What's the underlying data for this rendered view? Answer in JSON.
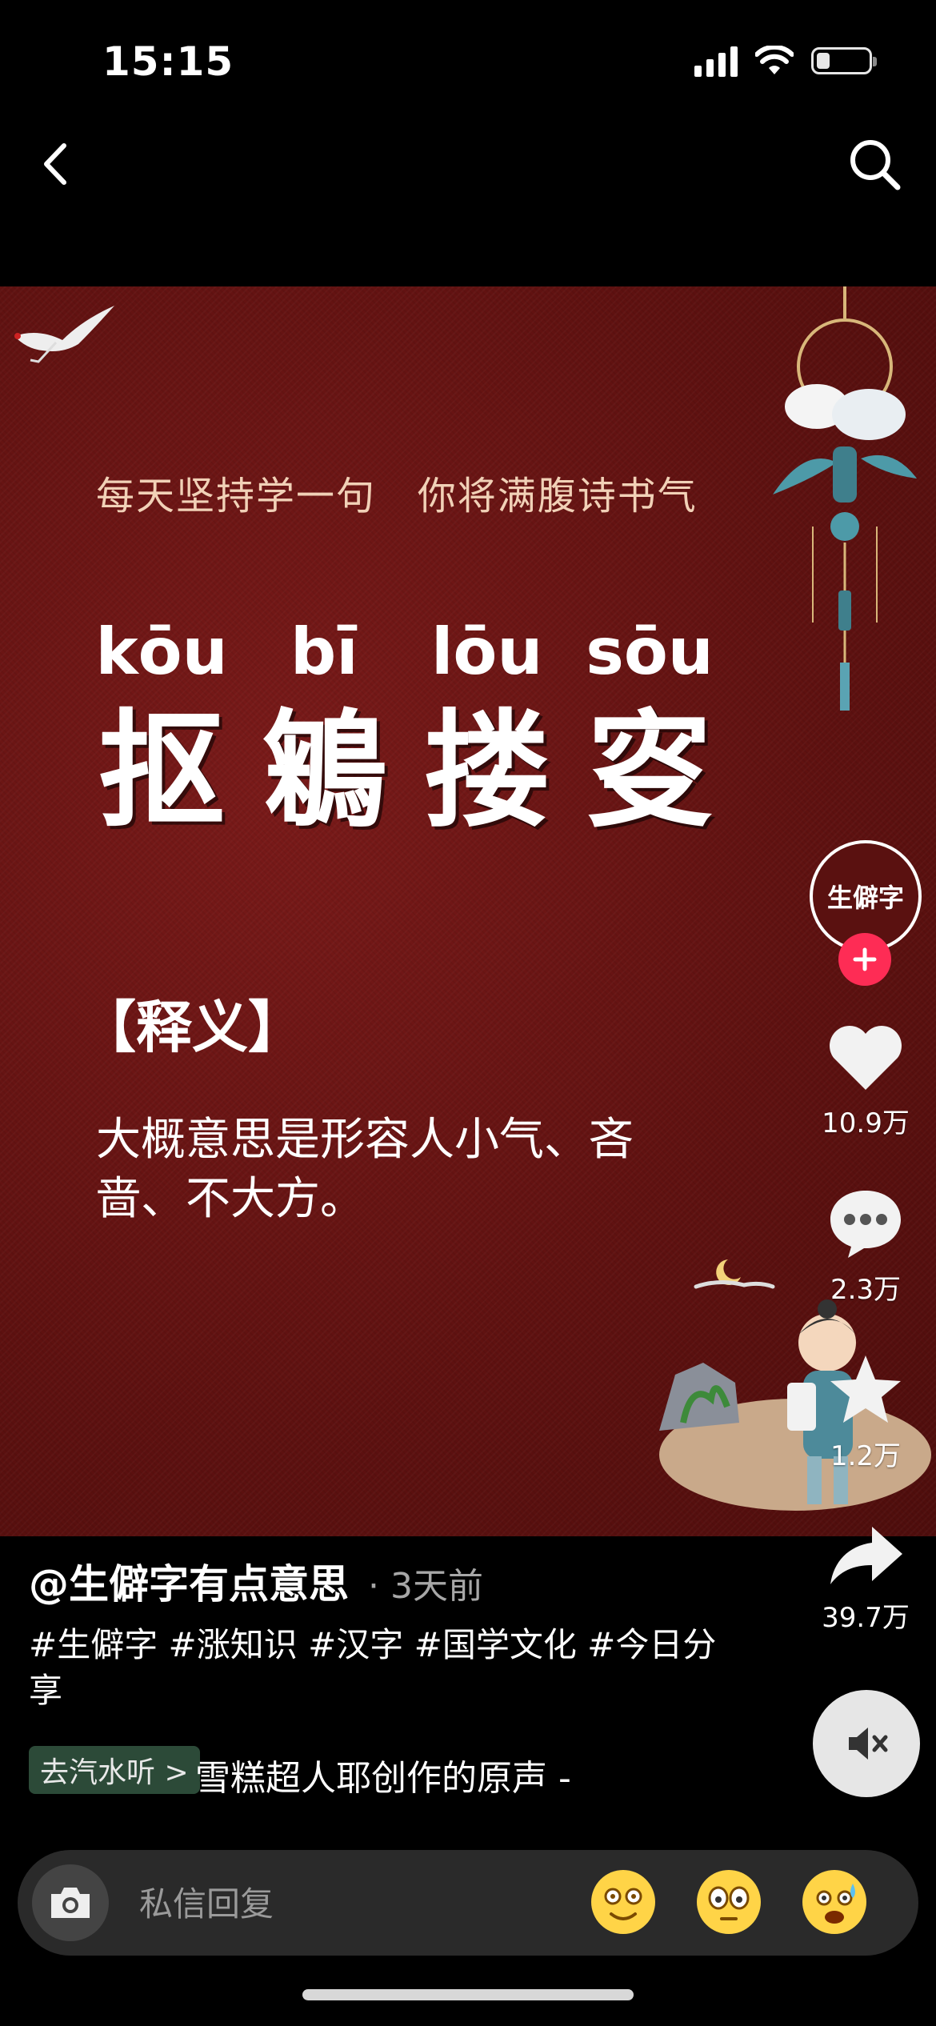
{
  "status_bar": {
    "time": "15:15",
    "battery_level": 0.25
  },
  "video": {
    "motto": "每天坚持学一句   你将满腹诗书气",
    "pinyin": [
      "kōu",
      "bī",
      "lōu",
      "sōu"
    ],
    "characters": [
      "抠",
      "鵴",
      "搂",
      "叜"
    ],
    "meaning_title": "【释义】",
    "meaning_body": "大概意思是形容人小气、吝啬、不大方。"
  },
  "actions": {
    "avatar_text": "生僻字",
    "likes": "10.9万",
    "comments": "2.3万",
    "favorites": "1.2万",
    "shares": "39.7万"
  },
  "post": {
    "author": "@生僻字有点意思",
    "time": "· 3天前",
    "tags": "#生僻字 #涨知识 #汉字 #国学文化 #今日分享",
    "music_badge": "去汽水听 >",
    "music_title": "雪糕超人耶创作的原声 -"
  },
  "reply_bar": {
    "placeholder": "私信回复"
  },
  "colors": {
    "accent": "#fe2c55",
    "video_bg": "#5e1110",
    "badge": "#2c4a38"
  },
  "icons": [
    "back-icon",
    "search-icon",
    "plus-icon",
    "heart-icon",
    "comment-icon",
    "star-icon",
    "share-icon",
    "mute-icon",
    "camera-icon"
  ]
}
